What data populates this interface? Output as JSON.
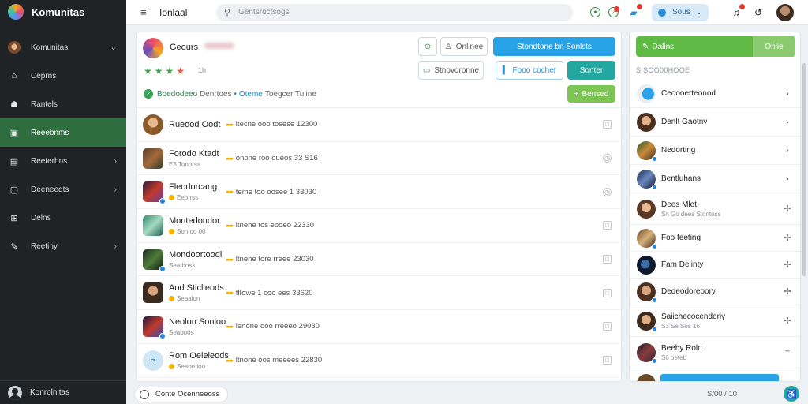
{
  "app": {
    "name": "Komunitas"
  },
  "sidebar": {
    "items": [
      {
        "label": "Komunitas",
        "icon": "community-avatar-icon",
        "chevron": "⌄"
      },
      {
        "label": "Ceprns",
        "icon": "home-icon",
        "chevron": ""
      },
      {
        "label": "Rantels",
        "icon": "group-icon",
        "chevron": ""
      },
      {
        "label": "Reeebnms",
        "icon": "board-icon",
        "chevron": "",
        "active": true
      },
      {
        "label": "Reeterbns",
        "icon": "calendar-icon",
        "chevron": "›"
      },
      {
        "label": "Deeneedts",
        "icon": "file-icon",
        "chevron": "›"
      },
      {
        "label": "Delns",
        "icon": "grid-icon",
        "chevron": ""
      },
      {
        "label": "Reetiny",
        "icon": "pen-icon",
        "chevron": "›"
      }
    ],
    "user_label": "Konrolnitas"
  },
  "topbar": {
    "title": "Ionlaal",
    "search_placeholder": "Gentsroctsogs",
    "pill_label": "Sous"
  },
  "main": {
    "group_name": "Geours",
    "rating_count": "1h",
    "buttons": {
      "online": "Onlinee",
      "contacts": "Stondtone bn Sonlsts",
      "folders": "Stnovoronne",
      "focus": "Fooo cocher",
      "connect": "Sonter",
      "new": "Bensed"
    },
    "status": {
      "green": "Boedodeeo",
      "gray": "Denrtoes",
      "blue": "Oteme",
      "rest": "Toegcer Tuline"
    },
    "rows": [
      {
        "name": "Rueood Oodt",
        "sub": "",
        "meta": "ltecne ooo tosese 12300",
        "mark": "□"
      },
      {
        "name": "Forodo Ktadt",
        "sub": "E3 Tonorss",
        "meta": "onone roo oueos 33 S16",
        "mark": "◷"
      },
      {
        "name": "Fleodorcang",
        "sub": "Eeb rss",
        "meta": "teme too oosee 1 33030",
        "mark": "◷"
      },
      {
        "name": "Montedondor",
        "sub": "Son oo 00",
        "meta": "ltnene tos eooeo 22330",
        "mark": "□"
      },
      {
        "name": "Mondoortoodl",
        "sub": "Seatboss",
        "meta": "ltnene tore rreee 23030",
        "mark": "□"
      },
      {
        "name": "Aod Sticlleods",
        "sub": "Seaalon",
        "meta": "tlfowe 1 coo ees 33620",
        "mark": "□"
      },
      {
        "name": "Neolon Sonloo",
        "sub": "Seaboos",
        "meta": "lenone ooo rreeeo 29030",
        "mark": "□"
      },
      {
        "name": "Rom Oeleleods",
        "sub": "Seabo loo",
        "meta": "ltnone oos meeees 22830",
        "mark": "□"
      },
      {
        "name": "",
        "sub": "",
        "meta": "",
        "mark": "□"
      }
    ]
  },
  "right": {
    "header_label": "Dalins",
    "header_tag": "Onlie",
    "section_title": "SISOO00HOOE",
    "people": [
      {
        "name": "Ceoooerteonod",
        "sub": "",
        "icon": "›"
      },
      {
        "name": "Denlt Gaotny",
        "sub": "",
        "icon": "›"
      },
      {
        "name": "Nedorting",
        "sub": "",
        "icon": "›"
      },
      {
        "name": "Bentluhans",
        "sub": "",
        "icon": "›"
      },
      {
        "name": "Dees Mlet",
        "sub": "Sn Go dees Stontoss",
        "icon": "✢"
      },
      {
        "name": "Foo feeting",
        "sub": "",
        "icon": "✢"
      },
      {
        "name": "Fam Deiinty",
        "sub": "",
        "icon": "✢"
      },
      {
        "name": "Dedeodoreoory",
        "sub": "",
        "icon": "✢"
      },
      {
        "name": "Saiichecocenderiy",
        "sub": "S3 Se Sos 16",
        "icon": "✢"
      },
      {
        "name": "Beeby Rolri",
        "sub": "S6 oeteb",
        "icon": "="
      }
    ]
  },
  "footer": {
    "pill_label": "Conte Ocenneeoss",
    "page": "S/00 / 10"
  },
  "colors": {
    "sidebar_bg": "#1f2326",
    "active_nav": "#2e6d3d",
    "primary_blue": "#29a3e8",
    "green_button": "#5fba46",
    "teal_button": "#23a7a0"
  }
}
